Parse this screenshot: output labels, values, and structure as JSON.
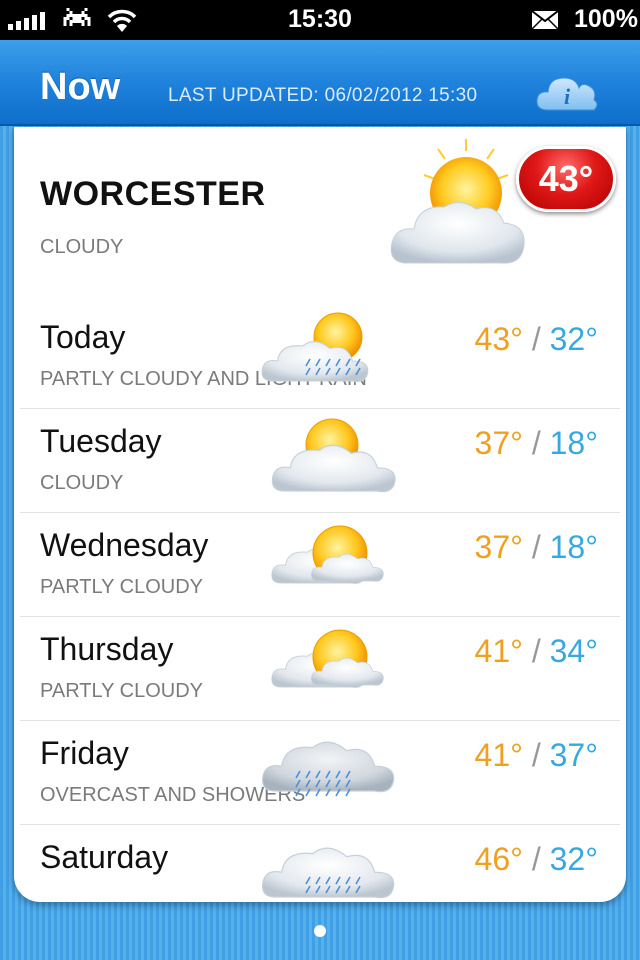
{
  "status_bar": {
    "time": "15:30",
    "battery": "100%",
    "icons": [
      "signal-icon",
      "space-invader-icon",
      "wifi-icon",
      "mail-icon"
    ]
  },
  "header": {
    "title": "Now",
    "last_updated": "LAST UPDATED: 06/02/2012 15:30",
    "info_icon": "info-cloud-icon"
  },
  "current": {
    "city": "WORCESTER",
    "condition": "CLOUDY",
    "temperature": "43°",
    "icon": "sun-cloud-icon"
  },
  "forecast": [
    {
      "day": "Today",
      "description": "PARTLY CLOUDY AND LIGHT RAIN",
      "high": "43°",
      "separator": "/",
      "low": "32°",
      "icon": "sun-cloud-rain-icon"
    },
    {
      "day": "Tuesday",
      "description": "CLOUDY",
      "high": "37°",
      "separator": "/",
      "low": "18°",
      "icon": "sun-cloud-icon"
    },
    {
      "day": "Wednesday",
      "description": "PARTLY CLOUDY",
      "high": "37°",
      "separator": "/",
      "low": "18°",
      "icon": "sun-cloud-icon"
    },
    {
      "day": "Thursday",
      "description": "PARTLY CLOUDY",
      "high": "41°",
      "separator": "/",
      "low": "34°",
      "icon": "sun-cloud-icon"
    },
    {
      "day": "Friday",
      "description": "OVERCAST AND SHOWERS",
      "high": "41°",
      "separator": "/",
      "low": "37°",
      "icon": "cloud-rain-icon"
    },
    {
      "day": "Saturday",
      "description": "",
      "high": "46°",
      "separator": "/",
      "low": "32°",
      "icon": "cloud-rain-icon"
    }
  ],
  "colors": {
    "high": "#f0a020",
    "low": "#36a9e0",
    "badge": "#e01818",
    "header": "#1f82dc"
  },
  "pager": {
    "pages": 1,
    "current": 1
  }
}
